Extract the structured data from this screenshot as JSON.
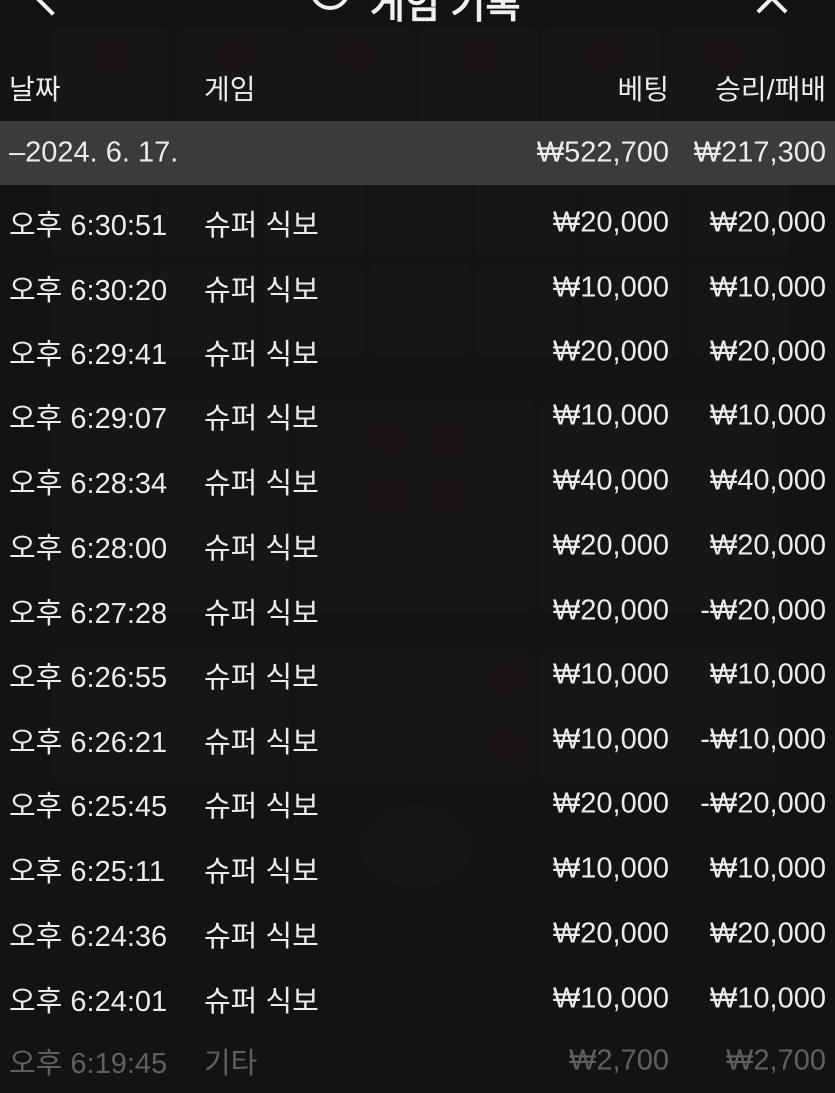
{
  "header": {
    "title": "게임 기록",
    "back_icon": "chevron-left-icon",
    "history_icon": "history-icon",
    "close_icon": "close-icon"
  },
  "table": {
    "columns": {
      "date": "날짜",
      "game": "게임",
      "bet": "베팅",
      "result": "승리/패배"
    },
    "date_group": {
      "label": "–2024. 6. 17.",
      "bet_total": "₩522,700",
      "result_total": "₩217,300"
    },
    "rows": [
      {
        "time": "오후 6:30:51",
        "game": "슈퍼 식보",
        "bet": "₩20,000",
        "result": "₩20,000"
      },
      {
        "time": "오후 6:30:20",
        "game": "슈퍼 식보",
        "bet": "₩10,000",
        "result": "₩10,000"
      },
      {
        "time": "오후 6:29:41",
        "game": "슈퍼 식보",
        "bet": "₩20,000",
        "result": "₩20,000"
      },
      {
        "time": "오후 6:29:07",
        "game": "슈퍼 식보",
        "bet": "₩10,000",
        "result": "₩10,000"
      },
      {
        "time": "오후 6:28:34",
        "game": "슈퍼 식보",
        "bet": "₩40,000",
        "result": "₩40,000"
      },
      {
        "time": "오후 6:28:00",
        "game": "슈퍼 식보",
        "bet": "₩20,000",
        "result": "₩20,000"
      },
      {
        "time": "오후 6:27:28",
        "game": "슈퍼 식보",
        "bet": "₩20,000",
        "result": "-₩20,000"
      },
      {
        "time": "오후 6:26:55",
        "game": "슈퍼 식보",
        "bet": "₩10,000",
        "result": "₩10,000"
      },
      {
        "time": "오후 6:26:21",
        "game": "슈퍼 식보",
        "bet": "₩10,000",
        "result": "-₩10,000"
      },
      {
        "time": "오후 6:25:45",
        "game": "슈퍼 식보",
        "bet": "₩20,000",
        "result": "-₩20,000"
      },
      {
        "time": "오후 6:25:11",
        "game": "슈퍼 식보",
        "bet": "₩10,000",
        "result": "₩10,000"
      },
      {
        "time": "오후 6:24:36",
        "game": "슈퍼 식보",
        "bet": "₩20,000",
        "result": "₩20,000"
      },
      {
        "time": "오후 6:24:01",
        "game": "슈퍼 식보",
        "bet": "₩10,000",
        "result": "₩10,000"
      },
      {
        "time": "오후 6:19:45",
        "game": "기타",
        "bet": "₩2,700",
        "result": "₩2,700"
      }
    ]
  },
  "colors": {
    "background": "#141414",
    "date_row": "#3b3b3b",
    "text": "#ececec"
  }
}
